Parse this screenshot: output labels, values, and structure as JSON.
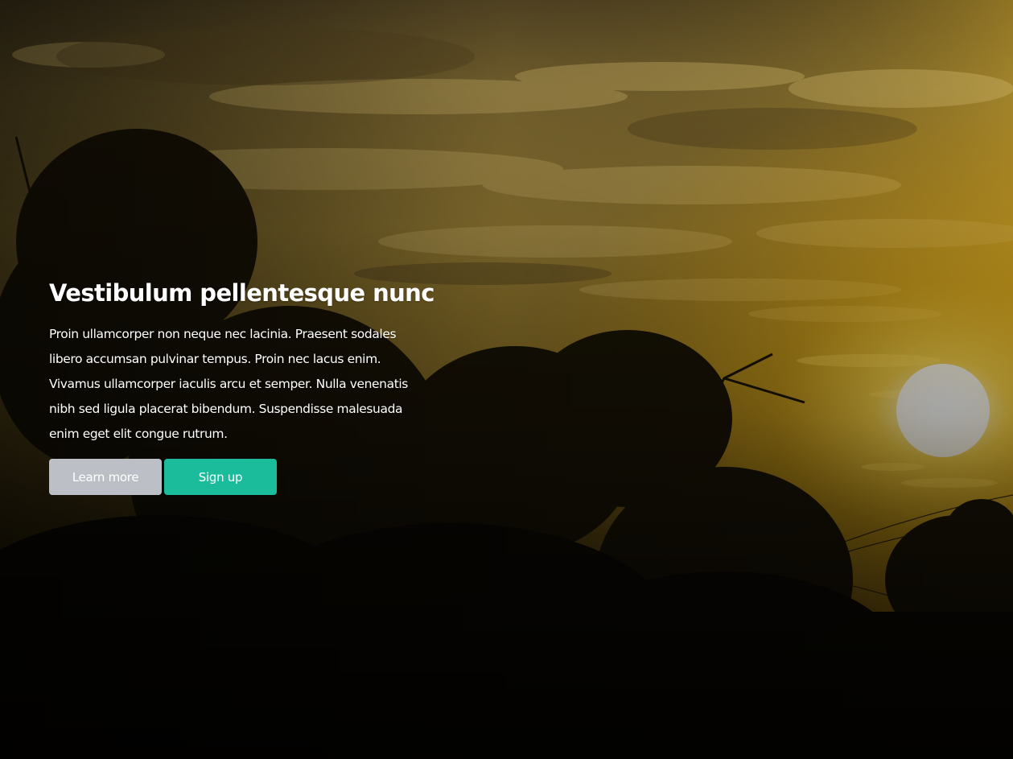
{
  "hero": {
    "headline": "Vestibulum pellentesque nunc",
    "body": "Proin ullamcorper non neque nec lacinia. Praesent sodales libero accumsan pulvinar tempus. Proin nec lacus enim. Vivamus ullamcorper iaculis arcu et semper. Nulla venenatis nibh sed ligula placerat bibendum. Suspendisse malesuada enim eget elit congue rutrum.",
    "learn_more_label": "Learn more",
    "sign_up_label": "Sign up"
  },
  "colors": {
    "learn_more_button": "#bcc0c6",
    "sign_up_button": "#1abc9c",
    "text": "#ffffff"
  },
  "background": {
    "image": "sunset-landscape-photo"
  }
}
